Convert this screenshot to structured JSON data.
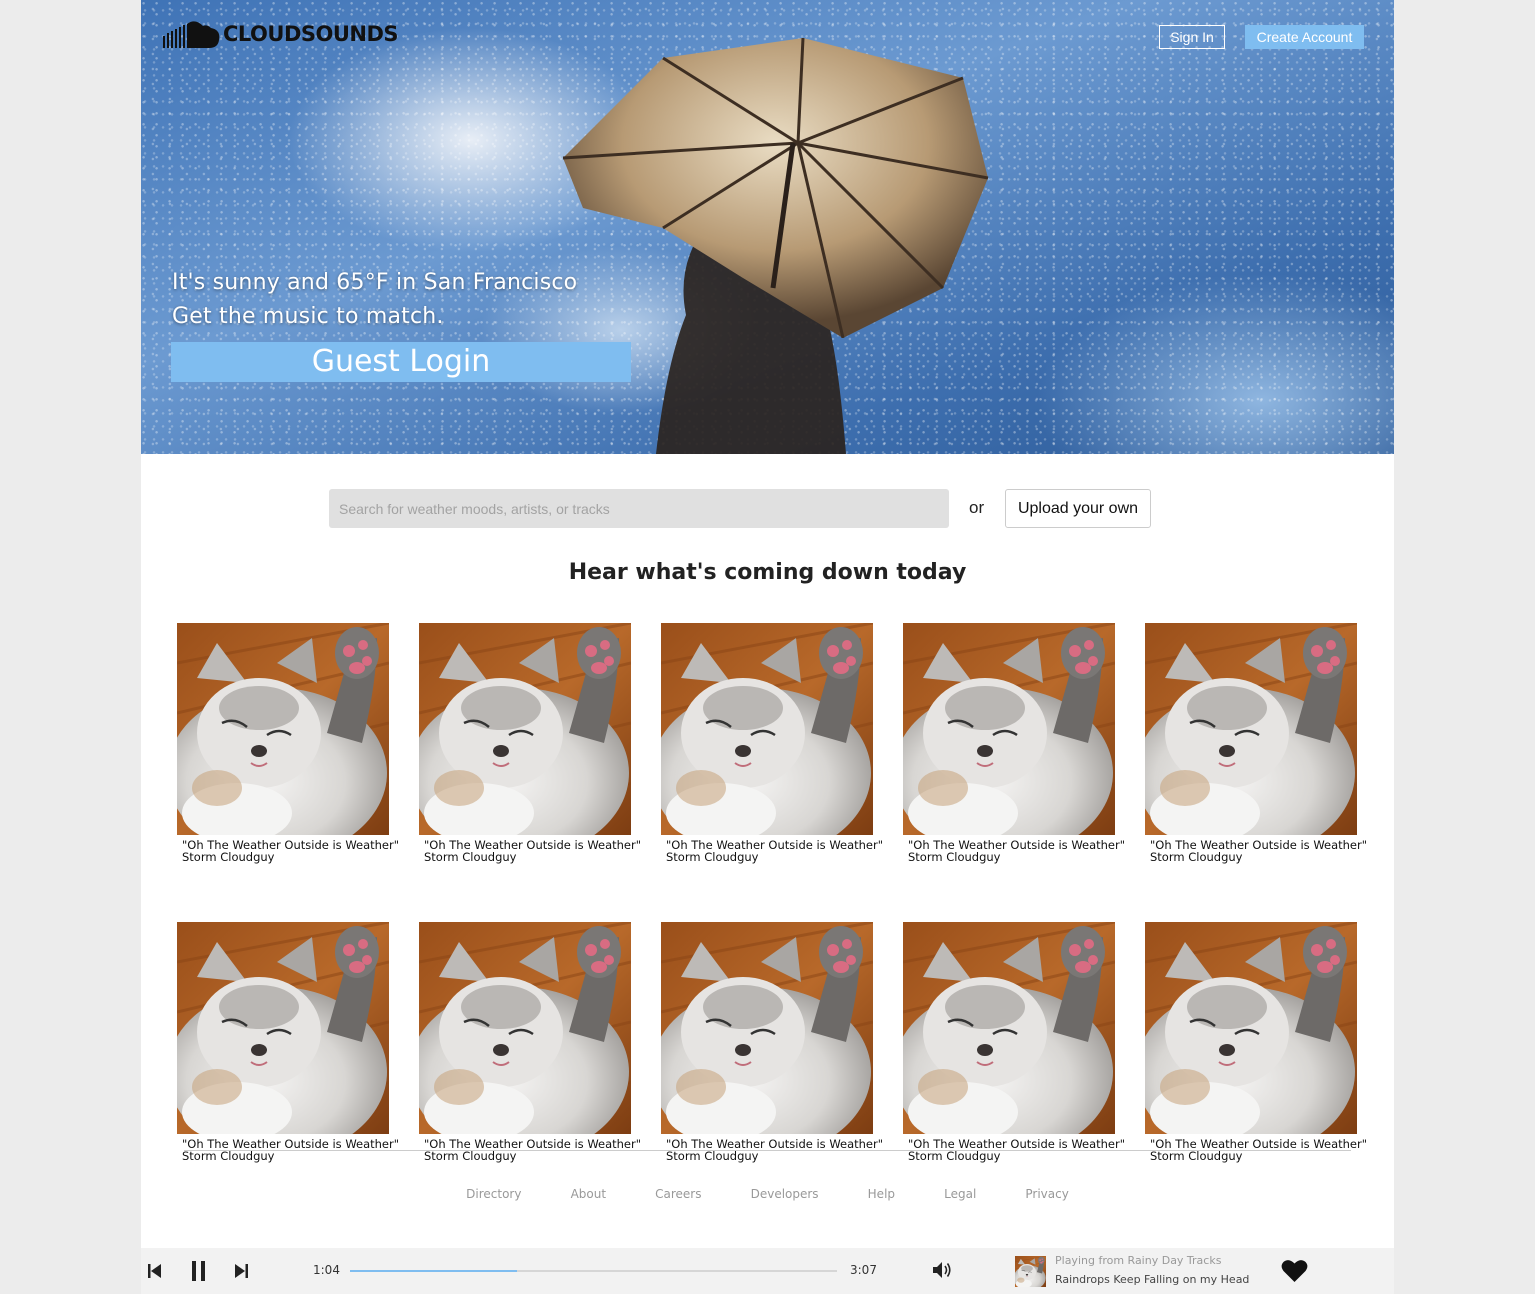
{
  "header": {
    "logo_text": "CLOUDSOUNDS",
    "sign_in_label": "Sign In",
    "create_account_label": "Create Account"
  },
  "hero": {
    "line1": "It's sunny and 65°F in San Francisco",
    "line2": "Get the music to match.",
    "guest_login_label": "Guest Login"
  },
  "search": {
    "placeholder": "Search for weather moods, artists, or tracks",
    "or_text": "or",
    "upload_label": "Upload your own"
  },
  "section_title": "Hear what's coming down today",
  "tracks": [
    {
      "title": "\"Oh The Weather Outside is Weather\"",
      "artist": "Storm Cloudguy"
    },
    {
      "title": "\"Oh The Weather Outside is Weather\"",
      "artist": "Storm Cloudguy"
    },
    {
      "title": "\"Oh The Weather Outside is Weather\"",
      "artist": "Storm Cloudguy"
    },
    {
      "title": "\"Oh The Weather Outside is Weather\"",
      "artist": "Storm Cloudguy"
    },
    {
      "title": "\"Oh The Weather Outside is Weather\"",
      "artist": "Storm Cloudguy"
    },
    {
      "title": "\"Oh The Weather Outside is Weather\"",
      "artist": "Storm Cloudguy"
    },
    {
      "title": "\"Oh The Weather Outside is Weather\"",
      "artist": "Storm Cloudguy"
    },
    {
      "title": "\"Oh The Weather Outside is Weather\"",
      "artist": "Storm Cloudguy"
    },
    {
      "title": "\"Oh The Weather Outside is Weather\"",
      "artist": "Storm Cloudguy"
    },
    {
      "title": "\"Oh The Weather Outside is Weather\"",
      "artist": "Storm Cloudguy"
    }
  ],
  "footer": {
    "links": [
      "Directory",
      "About",
      "Careers",
      "Developers",
      "Help",
      "Legal",
      "Privacy"
    ]
  },
  "player": {
    "elapsed": "1:04",
    "duration": "3:07",
    "progress_fraction": 0.342,
    "now_playing_source": "Playing from Rainy Day Tracks",
    "now_playing_title": "Raindrops Keep Falling on my Head",
    "icons": [
      "previous-icon",
      "pause-icon",
      "next-icon",
      "volume-icon",
      "heart-icon"
    ]
  },
  "colors": {
    "accent": "#7fbdf0",
    "background": "#ececec",
    "player_bg": "#f2f2f2"
  }
}
